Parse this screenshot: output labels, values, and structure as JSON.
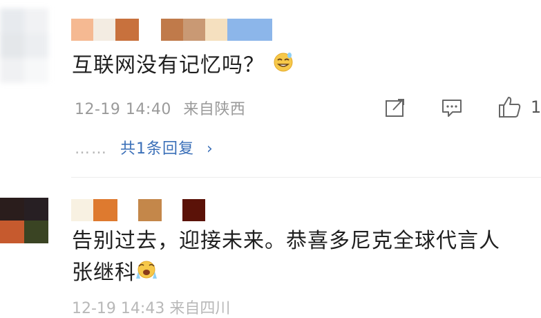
{
  "colors": {
    "text": "#1f1f1f",
    "meta": "#9a9a9a",
    "reply_link": "#3a6fb8",
    "divider": "#ececec"
  },
  "comment1": {
    "avatar_colors": [
      "#e7eaee",
      "#f1f2f4",
      "#e4e7ea",
      "#eceef1",
      "#f0f1f3",
      "#f7f8f9"
    ],
    "name_mosaic_colors": [
      "#f5b992",
      "#f3ece2",
      "#c8713d",
      "#ffffff",
      "#c07a4a",
      "#c99974",
      "#f5e0bf",
      "#8cb6ea"
    ],
    "text": "互联网没有记忆吗？",
    "emoji": "grin-sweat-emoji",
    "date": "12-19 14:40",
    "location": "来自陕西",
    "actions": [
      "share-icon",
      "comment-icon",
      "like-icon"
    ],
    "like_count": "1",
    "replies": {
      "dots": "……",
      "label": "共1条回复",
      "chevron": "›"
    }
  },
  "comment2": {
    "avatar_colors": [
      "#2a1d1c",
      "#271f23",
      "#c65a2e",
      "#3a4423"
    ],
    "name_mosaic_colors": [
      "#f8f1e2",
      "#de7a2f",
      "#ffffff",
      "#c4874a",
      "#ffffff",
      "#5b1208"
    ],
    "text_line1": "告别过去，迎接未来。恭喜多尼克全球代言人",
    "text_line2": "张继科",
    "emoji": "shocked-cry-emoji",
    "footer_partial": "12-19 14:43 来自四川"
  }
}
